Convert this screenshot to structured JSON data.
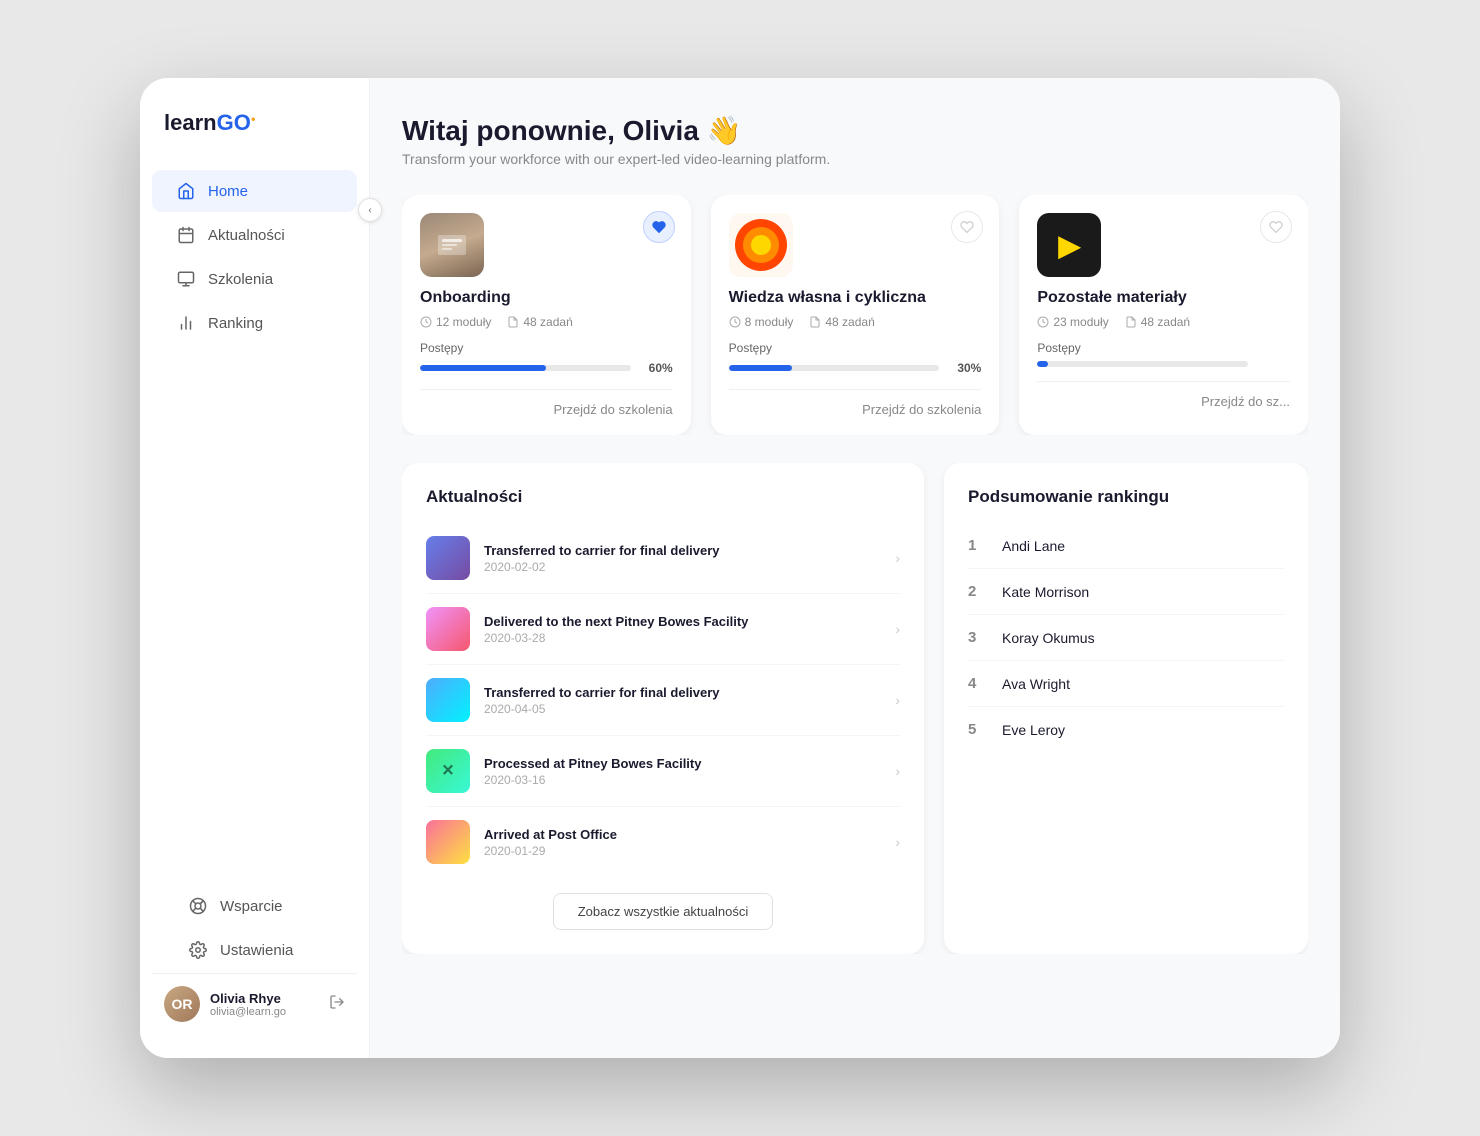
{
  "app": {
    "logo_learn": "learn",
    "logo_go": "GO",
    "logo_dot": "●"
  },
  "sidebar": {
    "nav_items": [
      {
        "id": "home",
        "label": "Home",
        "icon": "🏠",
        "active": true
      },
      {
        "id": "aktualnosci",
        "label": "Aktualności",
        "icon": "📅",
        "active": false
      },
      {
        "id": "szkolenia",
        "label": "Szkolenia",
        "icon": "🖥",
        "active": false
      },
      {
        "id": "ranking",
        "label": "Ranking",
        "icon": "📊",
        "active": false
      }
    ],
    "bottom_items": [
      {
        "id": "wsparcie",
        "label": "Wsparcie",
        "icon": "⚙"
      },
      {
        "id": "ustawienia",
        "label": "Ustawienia",
        "icon": "⚙"
      }
    ],
    "user": {
      "name": "Olivia Rhye",
      "email": "olivia@learn.go",
      "initials": "OR"
    },
    "collapse_icon": "‹"
  },
  "header": {
    "greeting": "Witaj ponownie, Olivia 👋",
    "subtitle": "Transform your workforce with our expert-led video-learning platform."
  },
  "courses": [
    {
      "id": "onboarding",
      "title": "Onboarding",
      "modules": "12 moduły",
      "tasks": "48 zadań",
      "progress_label": "Postępy",
      "progress_pct": 60,
      "progress_display": "60%",
      "link": "Przejdź do szkolenia",
      "favorited": true
    },
    {
      "id": "wiedza",
      "title": "Wiedza własna i cykliczna",
      "modules": "8 moduły",
      "tasks": "48 zadań",
      "progress_label": "Postępy",
      "progress_pct": 30,
      "progress_display": "30%",
      "link": "Przejdź do szkolenia",
      "favorited": false
    },
    {
      "id": "pozostale",
      "title": "Pozostałe materiały",
      "modules": "23 moduły",
      "tasks": "48 zadań",
      "progress_label": "Postępy",
      "progress_pct": 5,
      "progress_display": "",
      "link": "Przejdź do sz...",
      "favorited": false
    }
  ],
  "news": {
    "section_title": "Aktualności",
    "items": [
      {
        "title": "Transferred to carrier for final delivery",
        "date": "2020-02-02"
      },
      {
        "title": "Delivered to the next Pitney Bowes Facility",
        "date": "2020-03-28"
      },
      {
        "title": "Transferred to carrier for final delivery",
        "date": "2020-04-05"
      },
      {
        "title": "Processed at Pitney Bowes Facility",
        "date": "2020-03-16"
      },
      {
        "title": "Arrived at Post Office",
        "date": "2020-01-29"
      }
    ],
    "see_all_btn": "Zobacz wszystkie aktualności"
  },
  "ranking": {
    "section_title": "Podsumowanie rankingu",
    "items": [
      {
        "rank": 1,
        "name": "Andi Lane"
      },
      {
        "rank": 2,
        "name": "Kate Morrison"
      },
      {
        "rank": 3,
        "name": "Koray Okumus"
      },
      {
        "rank": 4,
        "name": "Ava Wright"
      },
      {
        "rank": 5,
        "name": "Eve Leroy"
      }
    ]
  }
}
